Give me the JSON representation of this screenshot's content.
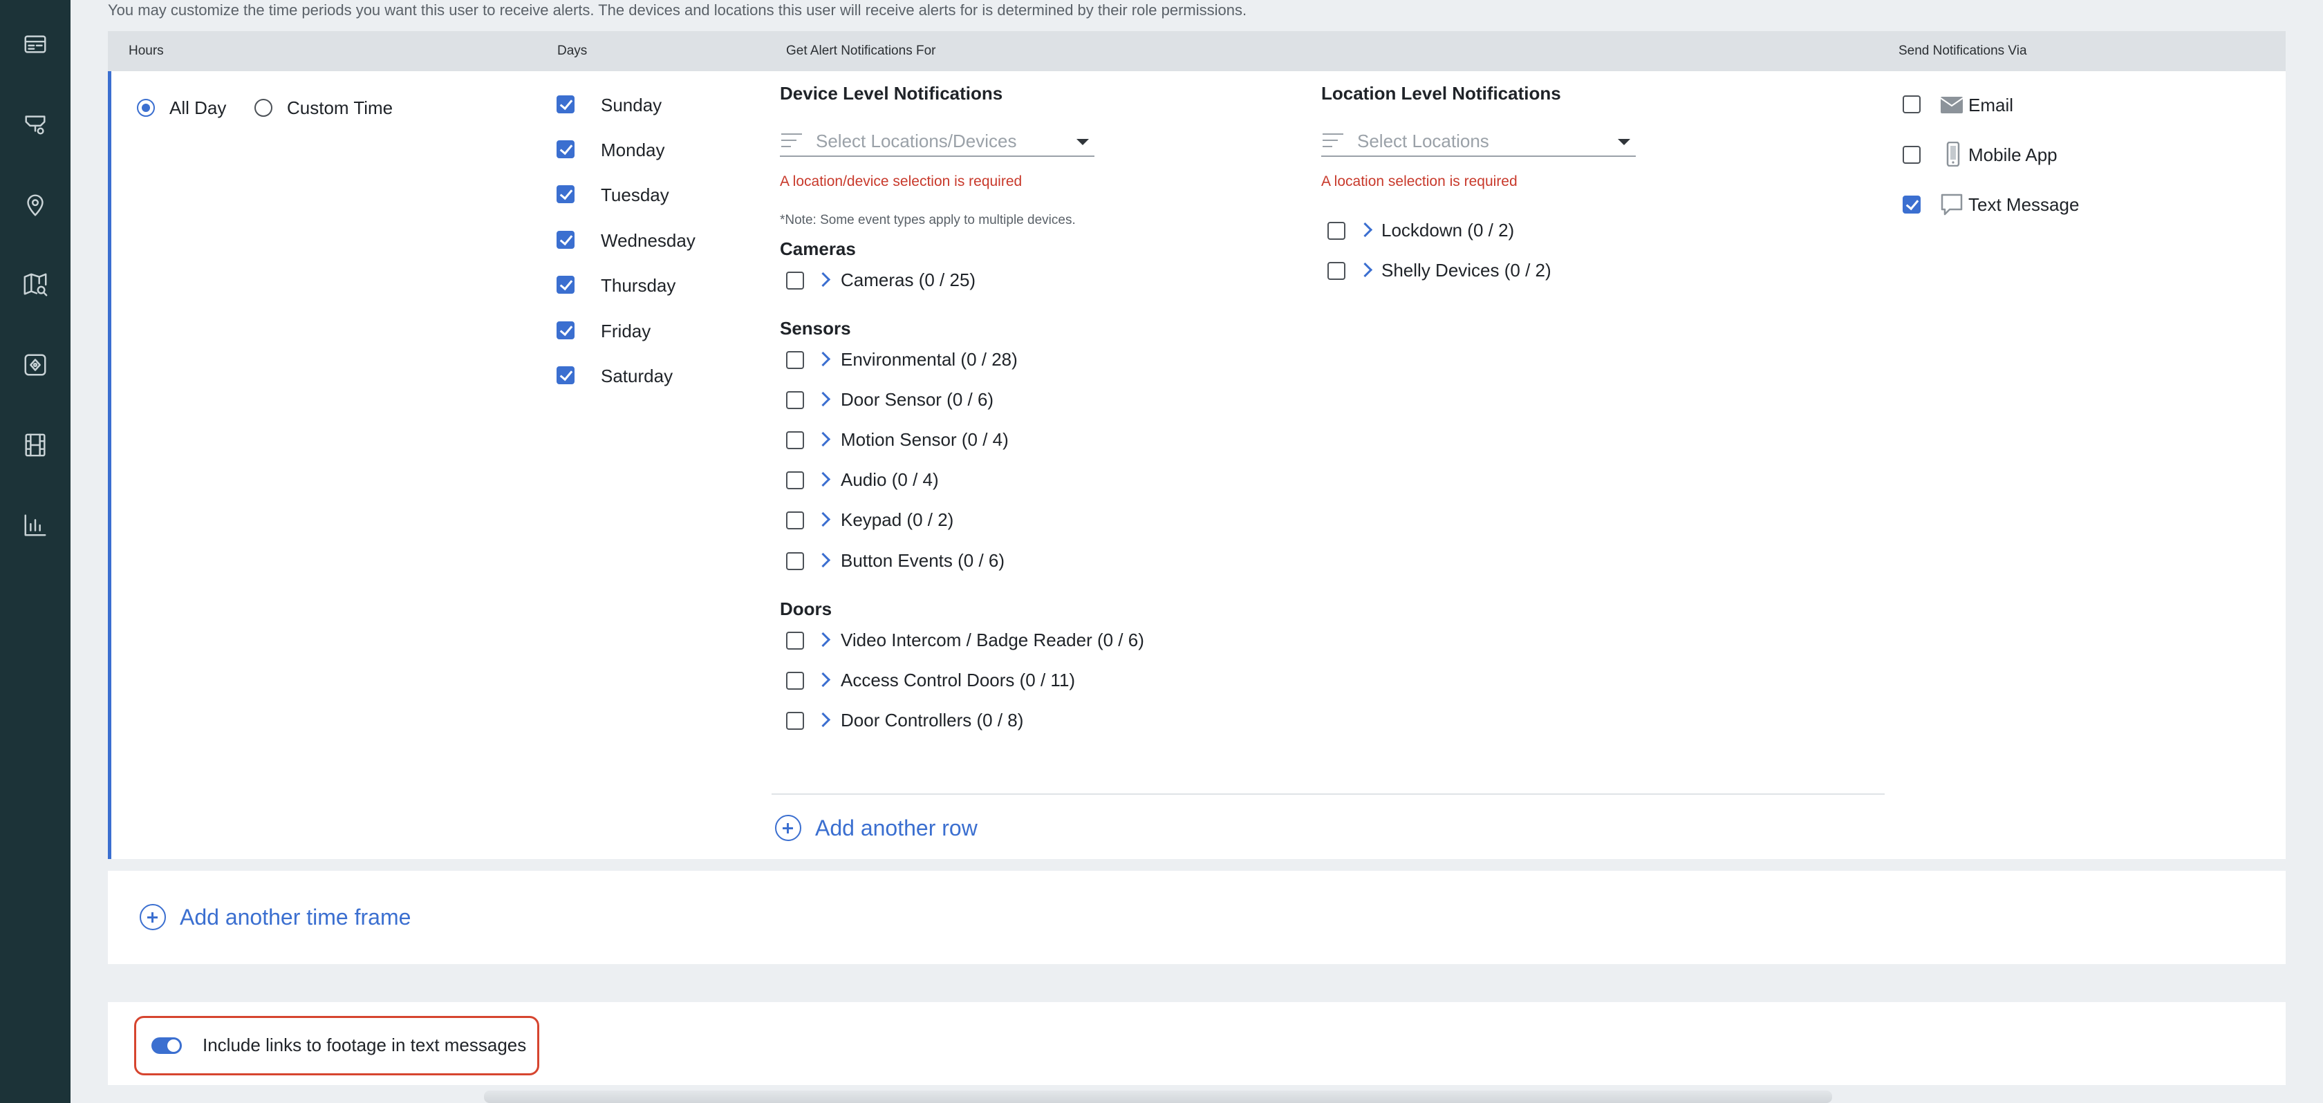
{
  "intro_text": "You may customize the time periods you want this user to receive alerts. The devices and locations this user will receive alerts for is determined by their role permissions.",
  "sidebar": {
    "items": [
      {
        "name": "cameras-grid-icon"
      },
      {
        "name": "security-camera-icon"
      },
      {
        "name": "location-pin-icon"
      },
      {
        "name": "map-search-icon"
      },
      {
        "name": "device-panel-icon"
      },
      {
        "name": "film-icon"
      },
      {
        "name": "bar-chart-icon"
      }
    ]
  },
  "header": {
    "hours": "Hours",
    "days": "Days",
    "alert_for": "Get Alert Notifications For",
    "send_via": "Send Notifications Via"
  },
  "hours": {
    "options": [
      {
        "label": "All Day",
        "selected": true
      },
      {
        "label": "Custom Time",
        "selected": false
      }
    ]
  },
  "days": [
    {
      "label": "Sunday",
      "checked": true
    },
    {
      "label": "Monday",
      "checked": true
    },
    {
      "label": "Tuesday",
      "checked": true
    },
    {
      "label": "Wednesday",
      "checked": true
    },
    {
      "label": "Thursday",
      "checked": true
    },
    {
      "label": "Friday",
      "checked": true
    },
    {
      "label": "Saturday",
      "checked": true
    }
  ],
  "device_level": {
    "title": "Device Level Notifications",
    "select_placeholder": "Select Locations/Devices",
    "error": "A location/device selection is required",
    "note": "*Note: Some event types apply to multiple devices.",
    "groups": [
      {
        "title": "Cameras",
        "items": [
          "Cameras (0 / 25)"
        ]
      },
      {
        "title": "Sensors",
        "items": [
          "Environmental (0 / 28)",
          "Door Sensor (0 / 6)",
          "Motion Sensor (0 / 4)",
          "Audio (0 / 4)",
          "Keypad (0 / 2)",
          "Button Events (0 / 6)"
        ]
      },
      {
        "title": "Doors",
        "items": [
          "Video Intercom / Badge Reader (0 / 6)",
          "Access Control Doors (0 / 11)",
          "Door Controllers (0 / 8)"
        ]
      }
    ]
  },
  "location_level": {
    "title": "Location Level Notifications",
    "select_placeholder": "Select Locations",
    "error": "A location selection is required",
    "items": [
      "Lockdown (0 / 2)",
      "Shelly Devices (0 / 2)"
    ]
  },
  "send_via": [
    {
      "label": "Email",
      "icon": "envelope-icon",
      "checked": false
    },
    {
      "label": "Mobile App",
      "icon": "phone-icon",
      "checked": false
    },
    {
      "label": "Text Message",
      "icon": "chat-bubble-icon",
      "checked": true
    }
  ],
  "actions": {
    "add_row": "Add another row",
    "add_time_frame": "Add another time frame"
  },
  "footage_toggle": {
    "label": "Include links to footage in text messages",
    "on": true
  },
  "colors": {
    "accent": "#3b6fd0",
    "sidebar": "#1c3338",
    "error": "#c8392b",
    "highlight_border": "#d6452f"
  }
}
